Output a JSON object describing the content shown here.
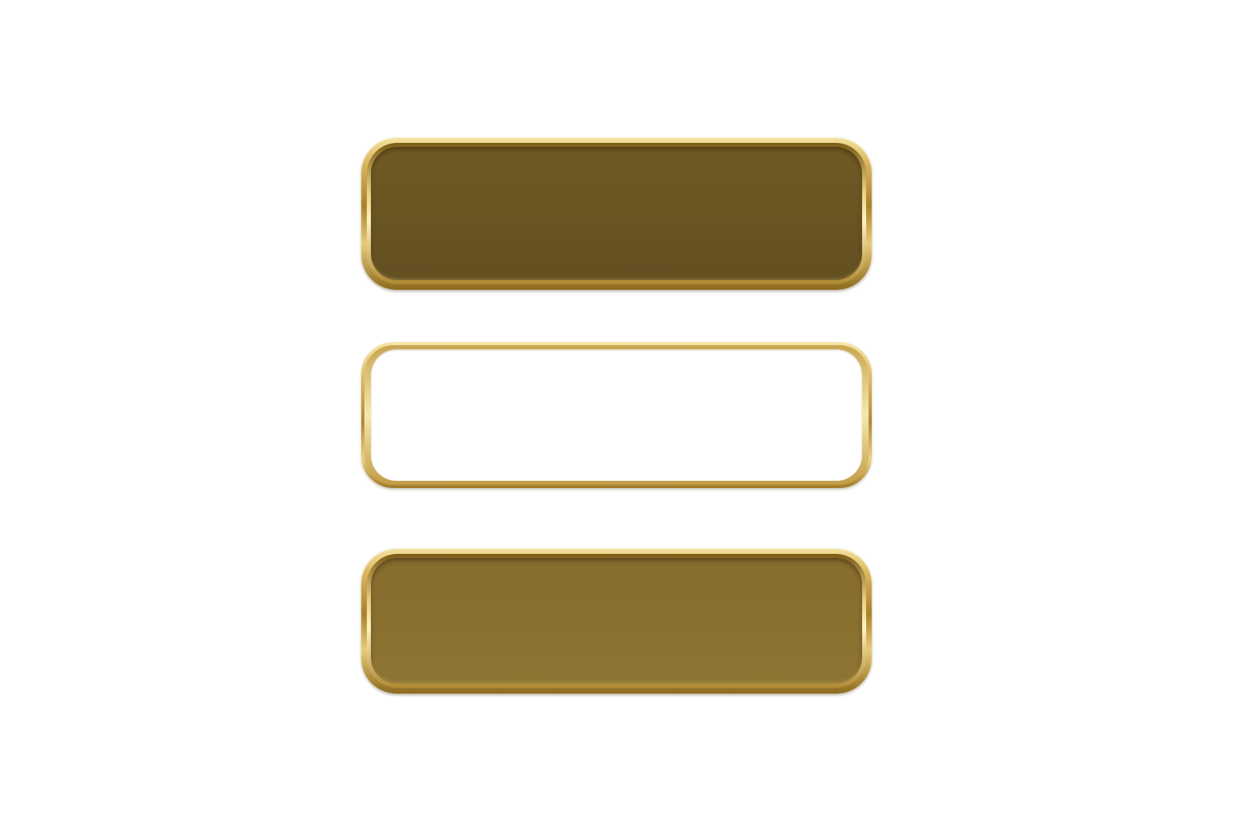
{
  "buttons": [
    {
      "id": "top",
      "label": "",
      "style": "filled-dark"
    },
    {
      "id": "middle",
      "label": "",
      "style": "outline"
    },
    {
      "id": "bottom",
      "label": "",
      "style": "filled-light"
    }
  ],
  "colors": {
    "background": "#ffffff",
    "gold_rim": "#d8b45a",
    "face_dark": "#6a5523",
    "face_light": "#8a702f",
    "face_outline": "#ffffff"
  }
}
